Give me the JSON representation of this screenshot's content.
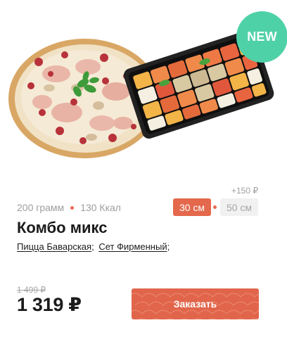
{
  "badge": {
    "label": "NEW",
    "color": "#4fd1a7"
  },
  "product": {
    "weight": "200 грамм",
    "calories": "130 Ккал",
    "title": "Комбо микс",
    "composition": [
      {
        "label": "Пицца Баварская",
        "sep": ";"
      },
      {
        "label": "Сет Фирменный",
        "sep": ";"
      }
    ]
  },
  "sizes": {
    "extra_price": "+150 ₽",
    "options": [
      {
        "label": "30 см",
        "selected": true
      },
      {
        "label": "50 см",
        "selected": false
      }
    ]
  },
  "pricing": {
    "old_price": "1 499 ₽",
    "price": "1 319 ₽"
  },
  "order_button": {
    "label": "Заказать",
    "color": "#e1654b"
  },
  "images": {
    "pizza": "pizza-image",
    "sushi_set": "sushi-tray-image"
  }
}
